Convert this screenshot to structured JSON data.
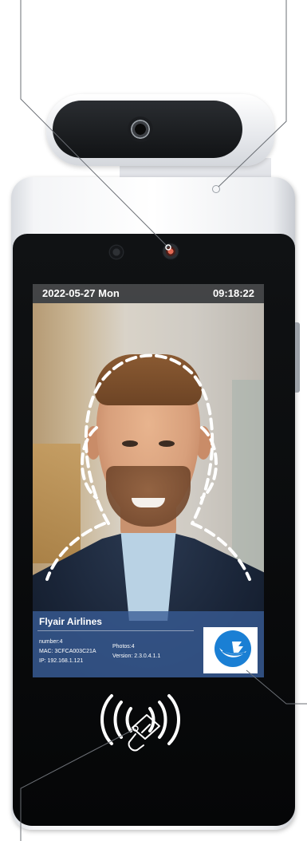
{
  "screen": {
    "date": "2022-05-27 Mon",
    "time": "09:18:22"
  },
  "info_panel": {
    "company": "Flyair Airlines",
    "number": "number:4",
    "mac": "MAC: 3CFCA003C21A",
    "ip": "IP: 192.168.1.121",
    "photos": "Photos:4",
    "version": "Version: 2.3.0.4.1.1"
  },
  "icons": {
    "logo": "airline-logo-icon",
    "nfc": "nfc-card-icon"
  },
  "colors": {
    "device_white": "#ffffff",
    "bezel": "#0b0c0e",
    "info_panel": "#385c96",
    "logo_blue": "#1a7fd4"
  }
}
